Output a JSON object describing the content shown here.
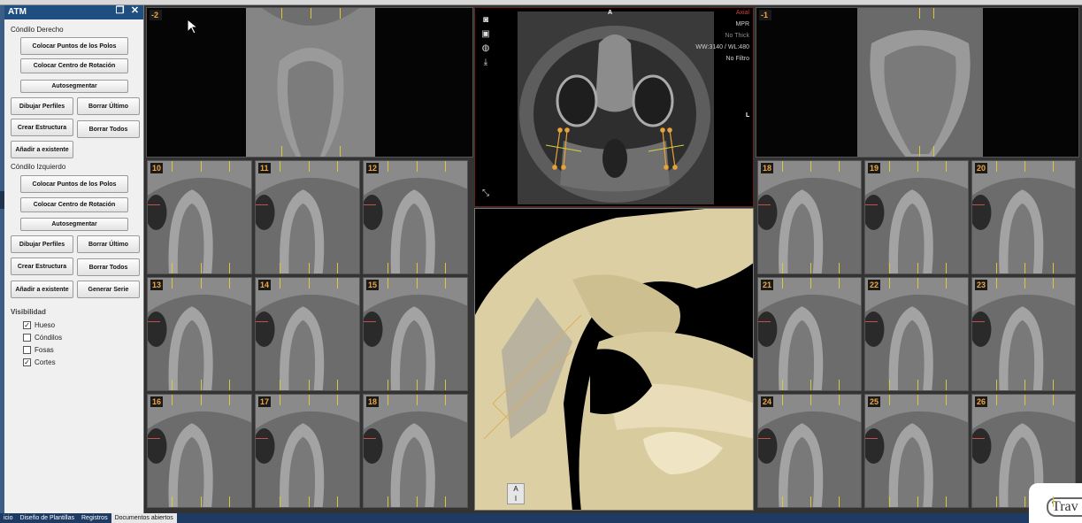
{
  "panel": {
    "title": "ATM",
    "right": {
      "label": "Cóndilo Derecho",
      "place_poles": "Colocar Puntos de los Polos",
      "place_center": "Colocar Centro de Rotación",
      "autoseg": "Autosegmentar",
      "draw_profiles": "Dibujar Perfiles",
      "delete_last": "Borrar Último",
      "create_structure": "Crear Estructura",
      "delete_all": "Borrar Todos",
      "add_existing": "Añadir a existente"
    },
    "left": {
      "label": "Cóndilo Izquierdo",
      "place_poles": "Colocar Puntos de los Polos",
      "place_center": "Colocar Centro de Rotación",
      "autoseg": "Autosegmentar",
      "draw_profiles": "Dibujar Perfiles",
      "delete_last": "Borrar Último",
      "create_structure": "Crear Estructura",
      "delete_all": "Borrar Todos",
      "add_existing": "Añadir a existente",
      "generate_series": "Generar Serie"
    },
    "visibility": {
      "label": "Visibilidad",
      "items": [
        {
          "label": "Hueso",
          "checked": true
        },
        {
          "label": "Cóndilos",
          "checked": false
        },
        {
          "label": "Fosas",
          "checked": false
        },
        {
          "label": "Cortes",
          "checked": true
        }
      ]
    }
  },
  "views": {
    "top_left_label": "-2",
    "top_right_label": "-1",
    "left_grid": [
      "10",
      "11",
      "12",
      "13",
      "14",
      "15",
      "16",
      "17",
      "18"
    ],
    "right_grid": [
      "18",
      "19",
      "20",
      "21",
      "22",
      "23",
      "24",
      "25",
      "26"
    ]
  },
  "axial": {
    "orientation_top": "A",
    "orientation_right": "L",
    "view_name": "Axial",
    "mode": "MPR",
    "thickness": "No Thick",
    "window": "WW:3140 / WL:480",
    "filter": "No Filtro",
    "icons": [
      "camera-icon",
      "image-icon",
      "globe-icon",
      "export-icon"
    ]
  },
  "view3d": {
    "orientation_cube": [
      "A",
      "I"
    ]
  },
  "taskbar": {
    "tabs": [
      {
        "label": "icio",
        "active": false
      },
      {
        "label": "Diseño de Plantillas",
        "active": false
      },
      {
        "label": "Registros",
        "active": false
      },
      {
        "label": "Documentos abiertos",
        "active": true
      }
    ]
  },
  "watermark": "Trav"
}
